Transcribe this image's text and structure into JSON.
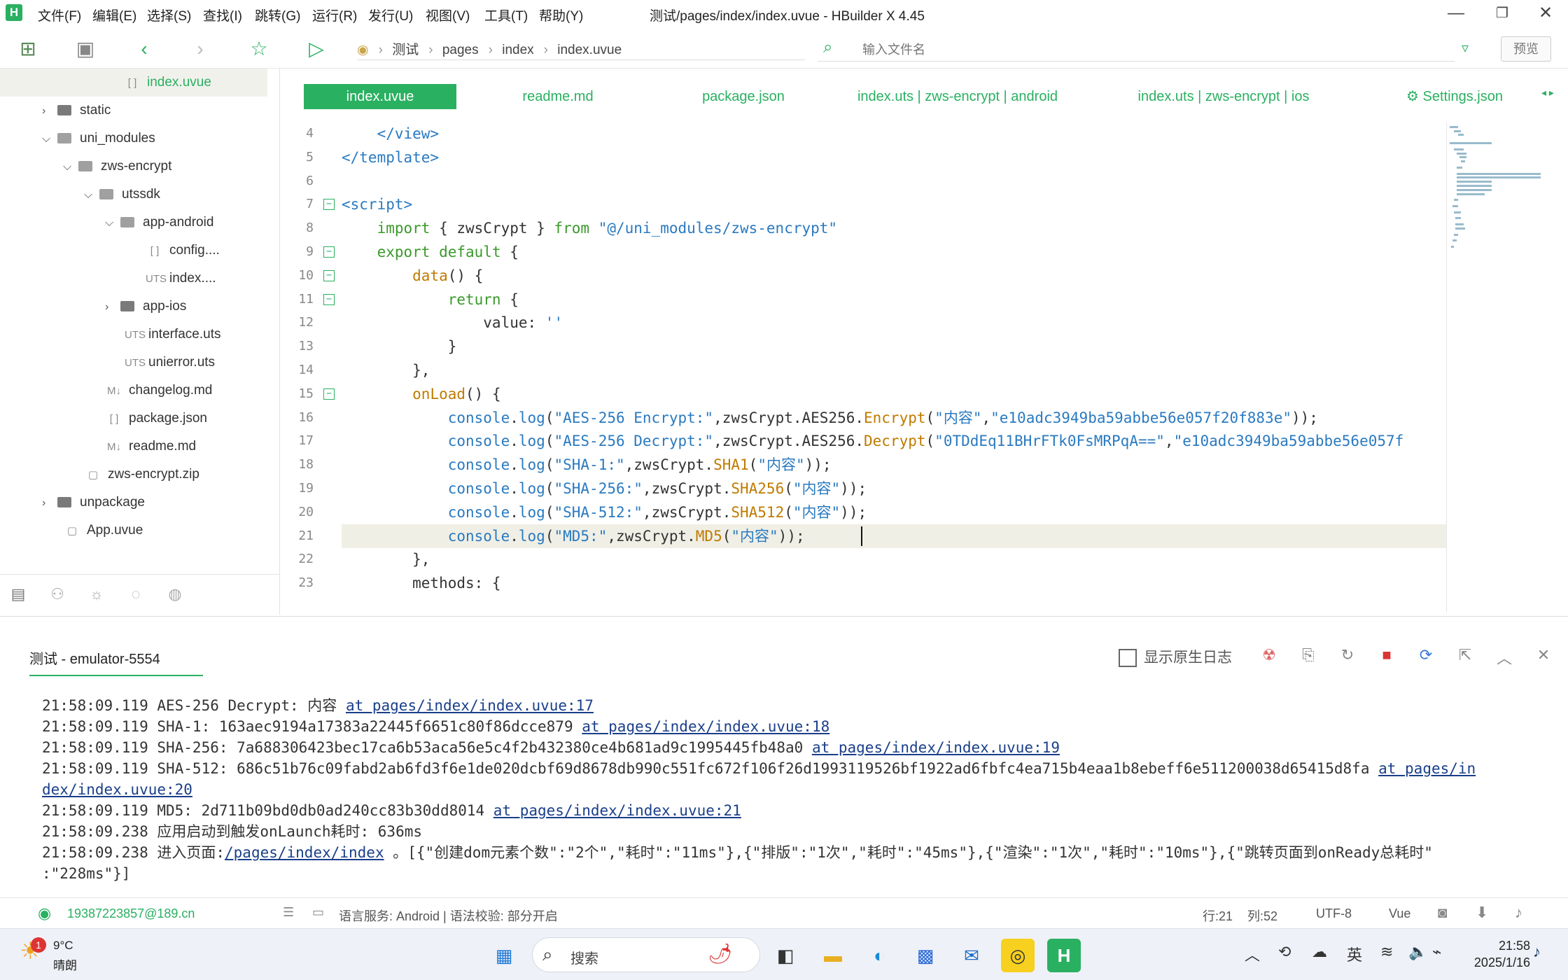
{
  "titlebar": {
    "menus": [
      "文件(F)",
      "编辑(E)",
      "选择(S)",
      "查找(I)",
      "跳转(G)",
      "运行(R)",
      "发行(U)",
      "视图(V)",
      "工具(T)",
      "帮助(Y)"
    ],
    "title": "测试/pages/index/index.uvue - HBuilder X 4.45",
    "logo": "H"
  },
  "toolbar": {
    "breadcrumb": [
      "测试",
      "pages",
      "index",
      "index.uvue"
    ],
    "search_placeholder": "输入文件名",
    "preview_label": "预览"
  },
  "sidebar": {
    "items": [
      {
        "label": "index.uvue",
        "indent": 0,
        "type": "file",
        "icon": "[ ]"
      },
      {
        "label": "static",
        "indent": 0,
        "type": "folder",
        "chev": "›"
      },
      {
        "label": "uni_modules",
        "indent": 0,
        "type": "folder-open",
        "chev": "⌄"
      },
      {
        "label": "zws-encrypt",
        "indent": 1,
        "type": "folder-open",
        "chev": "⌄"
      },
      {
        "label": "utssdk",
        "indent": 2,
        "type": "folder-open",
        "chev": "⌄"
      },
      {
        "label": "app-android",
        "indent": 3,
        "type": "folder-open",
        "chev": "⌄"
      },
      {
        "label": "config....",
        "indent": 4,
        "type": "file",
        "icon": "[ ]"
      },
      {
        "label": "index....",
        "indent": 4,
        "type": "file",
        "icon": "UTS"
      },
      {
        "label": "app-ios",
        "indent": 3,
        "type": "folder",
        "chev": "›"
      },
      {
        "label": "interface.uts",
        "indent": 3,
        "type": "file",
        "icon": "UTS"
      },
      {
        "label": "unierror.uts",
        "indent": 3,
        "type": "file",
        "icon": "UTS"
      },
      {
        "label": "changelog.md",
        "indent": 2,
        "type": "file",
        "icon": "M↓"
      },
      {
        "label": "package.json",
        "indent": 2,
        "type": "file",
        "icon": "[ ]"
      },
      {
        "label": "readme.md",
        "indent": 2,
        "type": "file",
        "icon": "M↓"
      },
      {
        "label": "zws-encrypt.zip",
        "indent": 1,
        "type": "file",
        "icon": "▢"
      },
      {
        "label": "unpackage",
        "indent": 0,
        "type": "folder",
        "chev": "›"
      },
      {
        "label": "App.uvue",
        "indent": 0,
        "type": "file",
        "icon": "▢"
      }
    ]
  },
  "tabs": [
    {
      "label": "index.uvue",
      "active": true
    },
    {
      "label": "readme.md"
    },
    {
      "label": "package.json"
    },
    {
      "label": "index.uts | zws-encrypt | android"
    },
    {
      "label": "index.uts | zws-encrypt | ios"
    },
    {
      "label": "⚙ Settings.json"
    }
  ],
  "editor": {
    "lines": [
      {
        "n": "4",
        "html": "    <span class='tag'>&lt;/view&gt;</span>"
      },
      {
        "n": "5",
        "html": "<span class='tag'>&lt;/template&gt;</span>"
      },
      {
        "n": "6",
        "html": ""
      },
      {
        "n": "7",
        "fold": true,
        "html": "<span class='tag'>&lt;script&gt;</span>"
      },
      {
        "n": "8",
        "html": "    <span class='kw'>import</span> { zwsCrypt } <span class='kw'>from</span> <span class='str'>\"@/uni_modules/zws-encrypt\"</span>"
      },
      {
        "n": "9",
        "fold": true,
        "html": "    <span class='kw'>export default</span> {"
      },
      {
        "n": "10",
        "fold": true,
        "html": "        <span class='fn'>data</span>() {"
      },
      {
        "n": "11",
        "fold": true,
        "html": "            <span class='kw'>return</span> {"
      },
      {
        "n": "12",
        "html": "                value: <span class='str'>''</span>"
      },
      {
        "n": "13",
        "html": "            }"
      },
      {
        "n": "14",
        "html": "        },"
      },
      {
        "n": "15",
        "fold": true,
        "html": "        <span class='fn'>onLoad</span>() {"
      },
      {
        "n": "16",
        "html": "            <span class='tag'>console</span>.<span class='tag'>log</span>(<span class='str'>\"AES-256 Encrypt:\"</span>,zwsCrypt.AES256.<span class='fn'>Encrypt</span>(<span class='str'>\"内容\"</span>,<span class='str'>\"e10adc3949ba59abbe56e057f20f883e\"</span>));"
      },
      {
        "n": "17",
        "html": "            <span class='tag'>console</span>.<span class='tag'>log</span>(<span class='str'>\"AES-256 Decrypt:\"</span>,zwsCrypt.AES256.<span class='fn'>Decrypt</span>(<span class='str'>\"0TDdEq11BHrFTk0FsMRPqA==\"</span>,<span class='str'>\"e10adc3949ba59abbe56e057f</span>"
      },
      {
        "n": "18",
        "html": "            <span class='tag'>console</span>.<span class='tag'>log</span>(<span class='str'>\"SHA-1:\"</span>,zwsCrypt.<span class='fn'>SHA1</span>(<span class='str'>\"内容\"</span>));"
      },
      {
        "n": "19",
        "html": "            <span class='tag'>console</span>.<span class='tag'>log</span>(<span class='str'>\"SHA-256:\"</span>,zwsCrypt.<span class='fn'>SHA256</span>(<span class='str'>\"内容\"</span>));"
      },
      {
        "n": "20",
        "html": "            <span class='tag'>console</span>.<span class='tag'>log</span>(<span class='str'>\"SHA-512:\"</span>,zwsCrypt.<span class='fn'>SHA512</span>(<span class='str'>\"内容\"</span>));"
      },
      {
        "n": "21",
        "current": true,
        "html": "            <span class='tag'>console</span>.<span class='tag'>log</span>(<span class='str'>\"MD5:\"</span>,zwsCrypt.<span class='fn'>MD5</span>(<span class='str'>\"内容\"</span>));"
      },
      {
        "n": "22",
        "html": "        },"
      },
      {
        "n": "23",
        "html": "        methods: {"
      }
    ]
  },
  "console": {
    "tab_label": "测试 - emulator-5554",
    "native_log_label": "显示原生日志",
    "logs": [
      {
        "text": "21:58:09.119 AES-256 Decrypt: 内容 ",
        "link": "at pages/index/index.uvue:17"
      },
      {
        "text": "21:58:09.119 SHA-1: 163aec9194a17383a22445f6651c80f86dcce879 ",
        "link": "at pages/index/index.uvue:18"
      },
      {
        "text": "21:58:09.119 SHA-256: 7a688306423bec17ca6b53aca56e5c4f2b432380ce4b681ad9c1995445fb48a0 ",
        "link": "at pages/index/index.uvue:19"
      },
      {
        "text": "21:58:09.119 SHA-512: 686c51b76c09fabd2ab6fd3f6e1de020dcbf69d8678db990c551fc672f106f26d1993119526bf1922ad6fbfc4ea715b4eaa1b8ebeff6e511200038d65415d8fa ",
        "link": "at pages/in"
      },
      {
        "text": "",
        "link": "dex/index.uvue:20"
      },
      {
        "text": "21:58:09.119 MD5: 2d711b09bd0db0ad240cc83b30dd8014 ",
        "link": "at pages/index/index.uvue:21"
      },
      {
        "text": "21:58:09.238 应用启动到触发onLaunch耗时: 636ms",
        "link": ""
      },
      {
        "text": "21:58:09.238 进入页面:",
        "link": "/pages/index/index",
        "after": " 。[{\"创建dom元素个数\":\"2个\",\"耗时\":\"11ms\"},{\"排版\":\"1次\",\"耗时\":\"45ms\"},{\"渲染\":\"1次\",\"耗时\":\"10ms\"},{\"跳转页面到onReady总耗时\""
      },
      {
        "text": ":\"228ms\"}]",
        "link": ""
      }
    ]
  },
  "statusbar": {
    "account": "19387223857@189.cn",
    "lang_service": "语言服务: Android | 语法校验: 部分开启",
    "row": "行:21",
    "col": "列:52",
    "encoding": "UTF-8",
    "lang": "Vue"
  },
  "taskbar": {
    "weather_temp": "9°C",
    "weather_desc": "晴朗",
    "weather_badge": "1",
    "search_label": "搜索",
    "ime": "英",
    "time": "21:58",
    "date": "2025/1/16"
  }
}
